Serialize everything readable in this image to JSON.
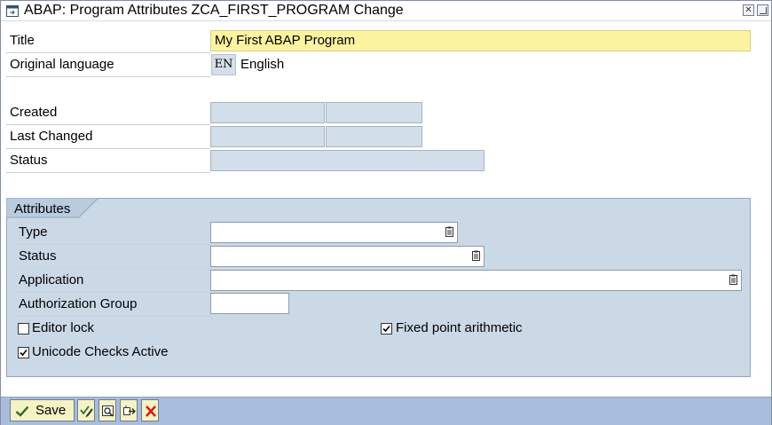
{
  "window": {
    "title": "ABAP: Program Attributes ZCA_FIRST_PROGRAM Change",
    "close_glyph": "✕"
  },
  "fields": {
    "title_label": "Title",
    "title_value": "My First ABAP Program",
    "orig_lang_label": "Original language",
    "orig_lang_code": "EN",
    "orig_lang_name": "English",
    "created_label": "Created",
    "last_changed_label": "Last Changed",
    "status_label": "Status"
  },
  "attributes": {
    "group_title": "Attributes",
    "type_label": "Type",
    "type_value": "",
    "status_label": "Status",
    "status_value": "",
    "application_label": "Application",
    "application_value": "",
    "auth_group_label": "Authorization Group",
    "auth_group_value": "",
    "editor_lock_label": "Editor lock",
    "editor_lock_checked": false,
    "fixed_point_label": "Fixed point arithmetic",
    "fixed_point_checked": true,
    "unicode_label": "Unicode Checks Active",
    "unicode_checked": true
  },
  "toolbar": {
    "save_label": "Save",
    "icons": [
      "save-check-icon",
      "edit-icon",
      "display-icon",
      "other-object-icon",
      "cancel-icon"
    ]
  },
  "colors": {
    "title_field_bg": "#fcf3a0",
    "group_bg": "#cbd9e7",
    "toolbar_bg": "#a8bddc",
    "save_btn_bg": "#f5f2c4",
    "cancel_red": "#d0201c"
  }
}
